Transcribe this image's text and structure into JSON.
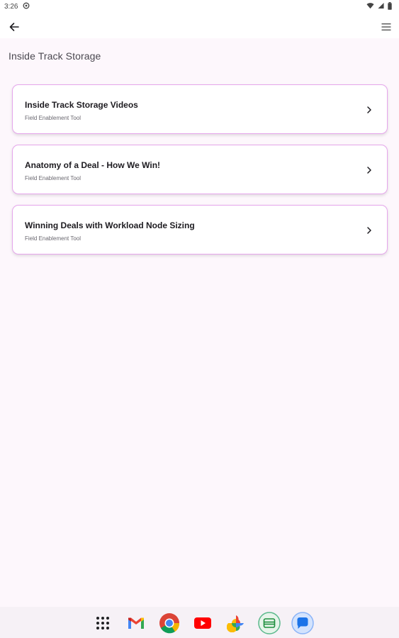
{
  "status_bar": {
    "time": "3:26"
  },
  "page": {
    "title": "Inside Track Storage"
  },
  "cards": [
    {
      "title": "Inside Track Storage Videos",
      "subtitle": "Field Enablement Tool"
    },
    {
      "title": "Anatomy of a Deal - How We Win!",
      "subtitle": "Field Enablement Tool"
    },
    {
      "title": "Winning Deals with Workload Node Sizing",
      "subtitle": "Field Enablement Tool"
    }
  ],
  "dock": {
    "apps": [
      "app-drawer-icon",
      "gmail-icon",
      "chrome-icon",
      "youtube-icon",
      "photos-icon",
      "wallet-icon",
      "messages-icon"
    ]
  },
  "colors": {
    "card_border": "#e6a6ec",
    "background": "#fdf7fc"
  }
}
